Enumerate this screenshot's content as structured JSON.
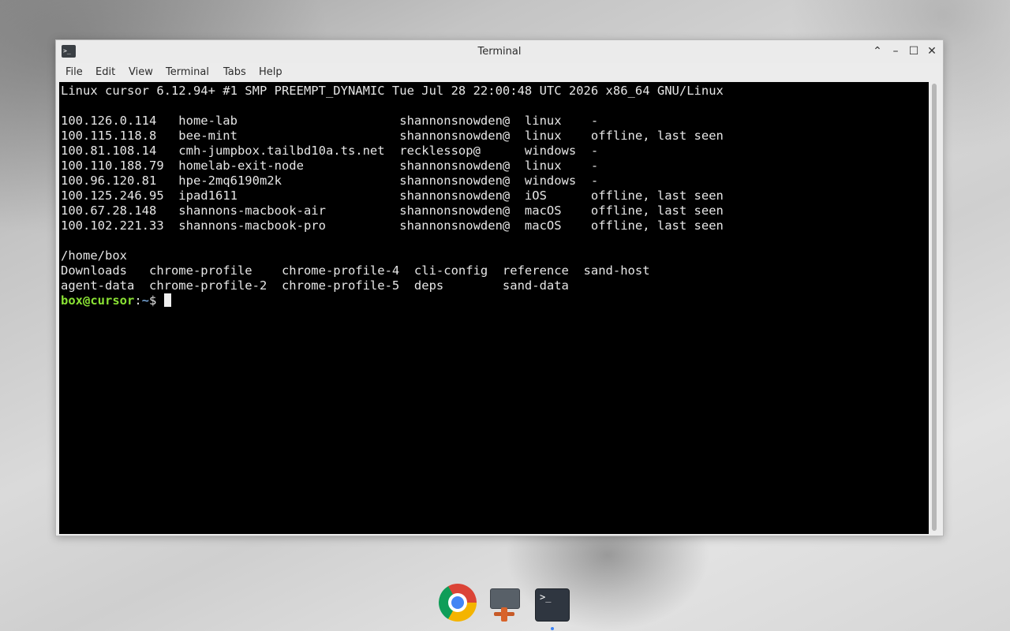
{
  "window": {
    "title": "Terminal",
    "controls": {
      "restore": "⌃",
      "minimize": "–",
      "maximize": "☐",
      "close": "✕"
    },
    "app_icon_glyph": ">_"
  },
  "menu": [
    "File",
    "Edit",
    "View",
    "Terminal",
    "Tabs",
    "Help"
  ],
  "terminal": {
    "uname": "Linux cursor 6.12.94+ #1 SMP PREEMPT_DYNAMIC Tue Jul 28 22:00:48 UTC 2026 x86_64 GNU/Linux",
    "devices": [
      "100.126.0.114   home-lab                      shannonsnowden@  linux    -",
      "100.115.118.8   bee-mint                      shannonsnowden@  linux    offline, last seen",
      "100.81.108.14   cmh-jumpbox.tailbd10a.ts.net  recklessop@      windows  -",
      "100.110.188.79  homelab-exit-node             shannonsnowden@  linux    -",
      "100.96.120.81   hpe-2mq6190m2k                shannonsnowden@  windows  -",
      "100.125.246.95  ipad1611                      shannonsnowden@  iOS      offline, last seen",
      "100.67.28.148   shannons-macbook-air          shannonsnowden@  macOS    offline, last seen",
      "100.102.221.33  shannons-macbook-pro          shannonsnowden@  macOS    offline, last seen"
    ],
    "pwd": "/home/box",
    "ls_rows": [
      "Downloads   chrome-profile    chrome-profile-4  cli-config  reference  sand-host",
      "agent-data  chrome-profile-2  chrome-profile-5  deps        sand-data"
    ],
    "prompt": {
      "user_host": "box@cursor",
      "sep": ":",
      "path": "~",
      "symbol": "$ "
    }
  },
  "dock": {
    "terminal_glyph": ">_"
  },
  "colors": {
    "prompt_user": "#8ae234",
    "prompt_path": "#729fcf",
    "terminal_bg": "#000000"
  }
}
